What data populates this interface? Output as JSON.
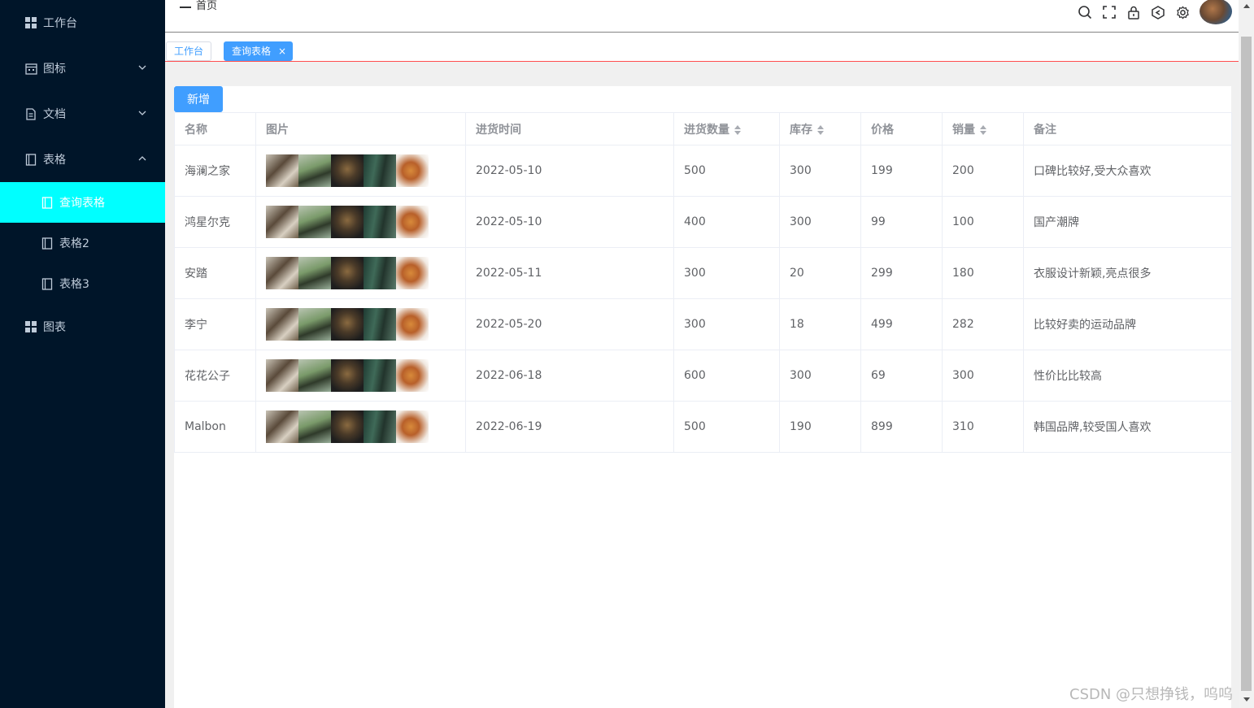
{
  "sidebar": {
    "items": [
      {
        "label": "工作台",
        "icon": "grid-icon"
      },
      {
        "label": "图标",
        "icon": "calendar-icon"
      },
      {
        "label": "文档",
        "icon": "document-icon"
      },
      {
        "label": "表格",
        "icon": "table-icon"
      },
      {
        "label": "查询表格",
        "icon": "table-icon"
      },
      {
        "label": "表格2",
        "icon": "table-icon"
      },
      {
        "label": "表格3",
        "icon": "table-icon"
      },
      {
        "label": "图表",
        "icon": "grid-icon"
      }
    ]
  },
  "header": {
    "breadcrumb": "首页",
    "icons": [
      "search-icon",
      "fullscreen-icon",
      "lock-icon",
      "theme-icon",
      "gear-icon",
      "avatar"
    ]
  },
  "tabs": {
    "home": "工作台",
    "active": "查询表格",
    "close": "×"
  },
  "toolbar": {
    "add_label": "新增"
  },
  "table": {
    "columns": [
      "名称",
      "图片",
      "进货时间",
      "进货数量",
      "库存",
      "价格",
      "销量",
      "备注"
    ],
    "rows": [
      {
        "name": "海澜之家",
        "date": "2022-05-10",
        "qty": "500",
        "stock": "300",
        "price": "199",
        "sales": "200",
        "note": "口碑比较好,受大众喜欢"
      },
      {
        "name": "鸿星尔克",
        "date": "2022-05-10",
        "qty": "400",
        "stock": "300",
        "price": "99",
        "sales": "100",
        "note": "国产潮牌"
      },
      {
        "name": "安踏",
        "date": "2022-05-11",
        "qty": "300",
        "stock": "20",
        "price": "299",
        "sales": "180",
        "note": "衣服设计新颖,亮点很多"
      },
      {
        "name": "李宁",
        "date": "2022-05-20",
        "qty": "300",
        "stock": "18",
        "price": "499",
        "sales": "282",
        "note": "比较好卖的运动品牌"
      },
      {
        "name": "花花公子",
        "date": "2022-06-18",
        "qty": "600",
        "stock": "300",
        "price": "69",
        "sales": "300",
        "note": "性价比比较高"
      },
      {
        "name": "Malbon",
        "date": "2022-06-19",
        "qty": "500",
        "stock": "190",
        "price": "899",
        "sales": "310",
        "note": "韩国品牌,较受国人喜欢"
      }
    ]
  },
  "watermark": "CSDN @只想挣钱，呜呜",
  "colors": {
    "sidebar_bg": "#001529",
    "active_item": "#00ffff",
    "primary": "#409eff",
    "tab_underline": "#ff4d4f"
  }
}
